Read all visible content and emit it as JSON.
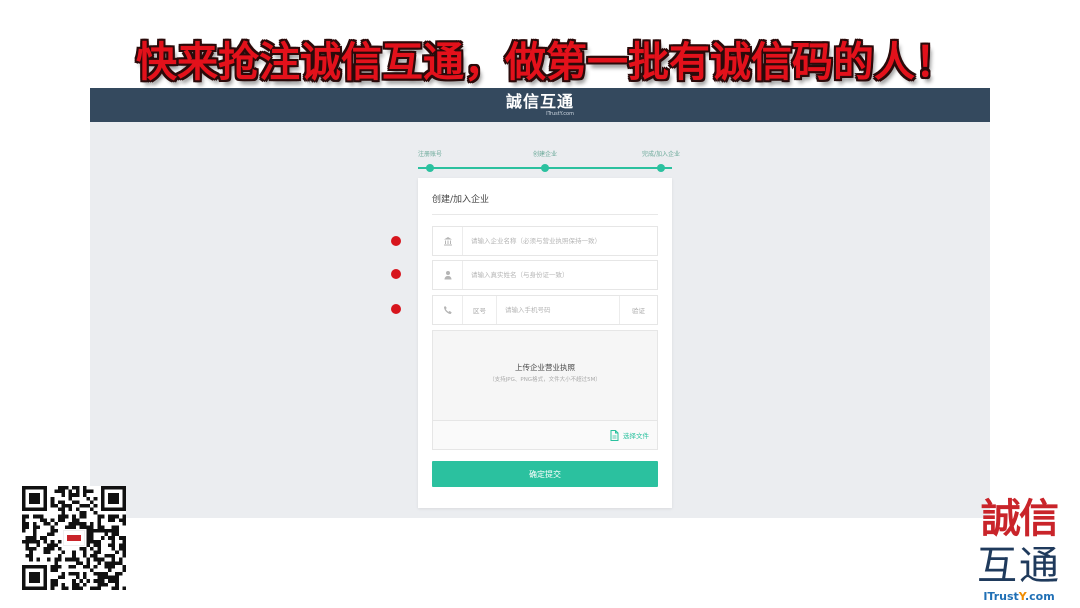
{
  "banner": {
    "text": "快来抢注诚信互通，做第一批有诚信码的人！"
  },
  "header": {
    "logo_text": "誠信互通",
    "logo_subtext": "ITrustY.com"
  },
  "steps": [
    {
      "label": "注册账号"
    },
    {
      "label": "创建企业"
    },
    {
      "label": "完成/加入企业"
    }
  ],
  "form": {
    "title": "创建/加入企业",
    "fields": [
      {
        "icon": "building-icon",
        "placeholder": "请输入企业名称（必须与营业执照保持一致）",
        "required": true
      },
      {
        "icon": "user-icon",
        "placeholder": "请输入真实姓名（与身份证一致）",
        "required": true
      },
      {
        "icon": "phone-icon",
        "prefix": "区号",
        "placeholder": "请输入手机号码",
        "suffix": "验证",
        "required": true
      }
    ],
    "upload": {
      "title": "上传企业营业执照",
      "hint": "（支持JPG、PNG格式，文件大小不超过5M）",
      "select_icon": "file-icon",
      "select_label": "选择文件"
    },
    "submit_label": "确定提交"
  },
  "qr_code": {
    "icon": "qr-code"
  },
  "brand": {
    "logo_top": "誠信",
    "logo_bottom": "互通",
    "domain_main": "ITrust",
    "domain_highlight": "Y",
    "domain_suffix": ".com"
  },
  "colors": {
    "banner_red": "#e3111b",
    "header_navy": "#34495e",
    "content_gray": "#ebedf0",
    "accent_teal": "#2bc19f",
    "required_red": "#d7151d",
    "brand_red": "#c9242a",
    "brand_navy": "#1f3a5c",
    "domain_blue": "#1f6fb5",
    "domain_orange": "#f08c00"
  }
}
